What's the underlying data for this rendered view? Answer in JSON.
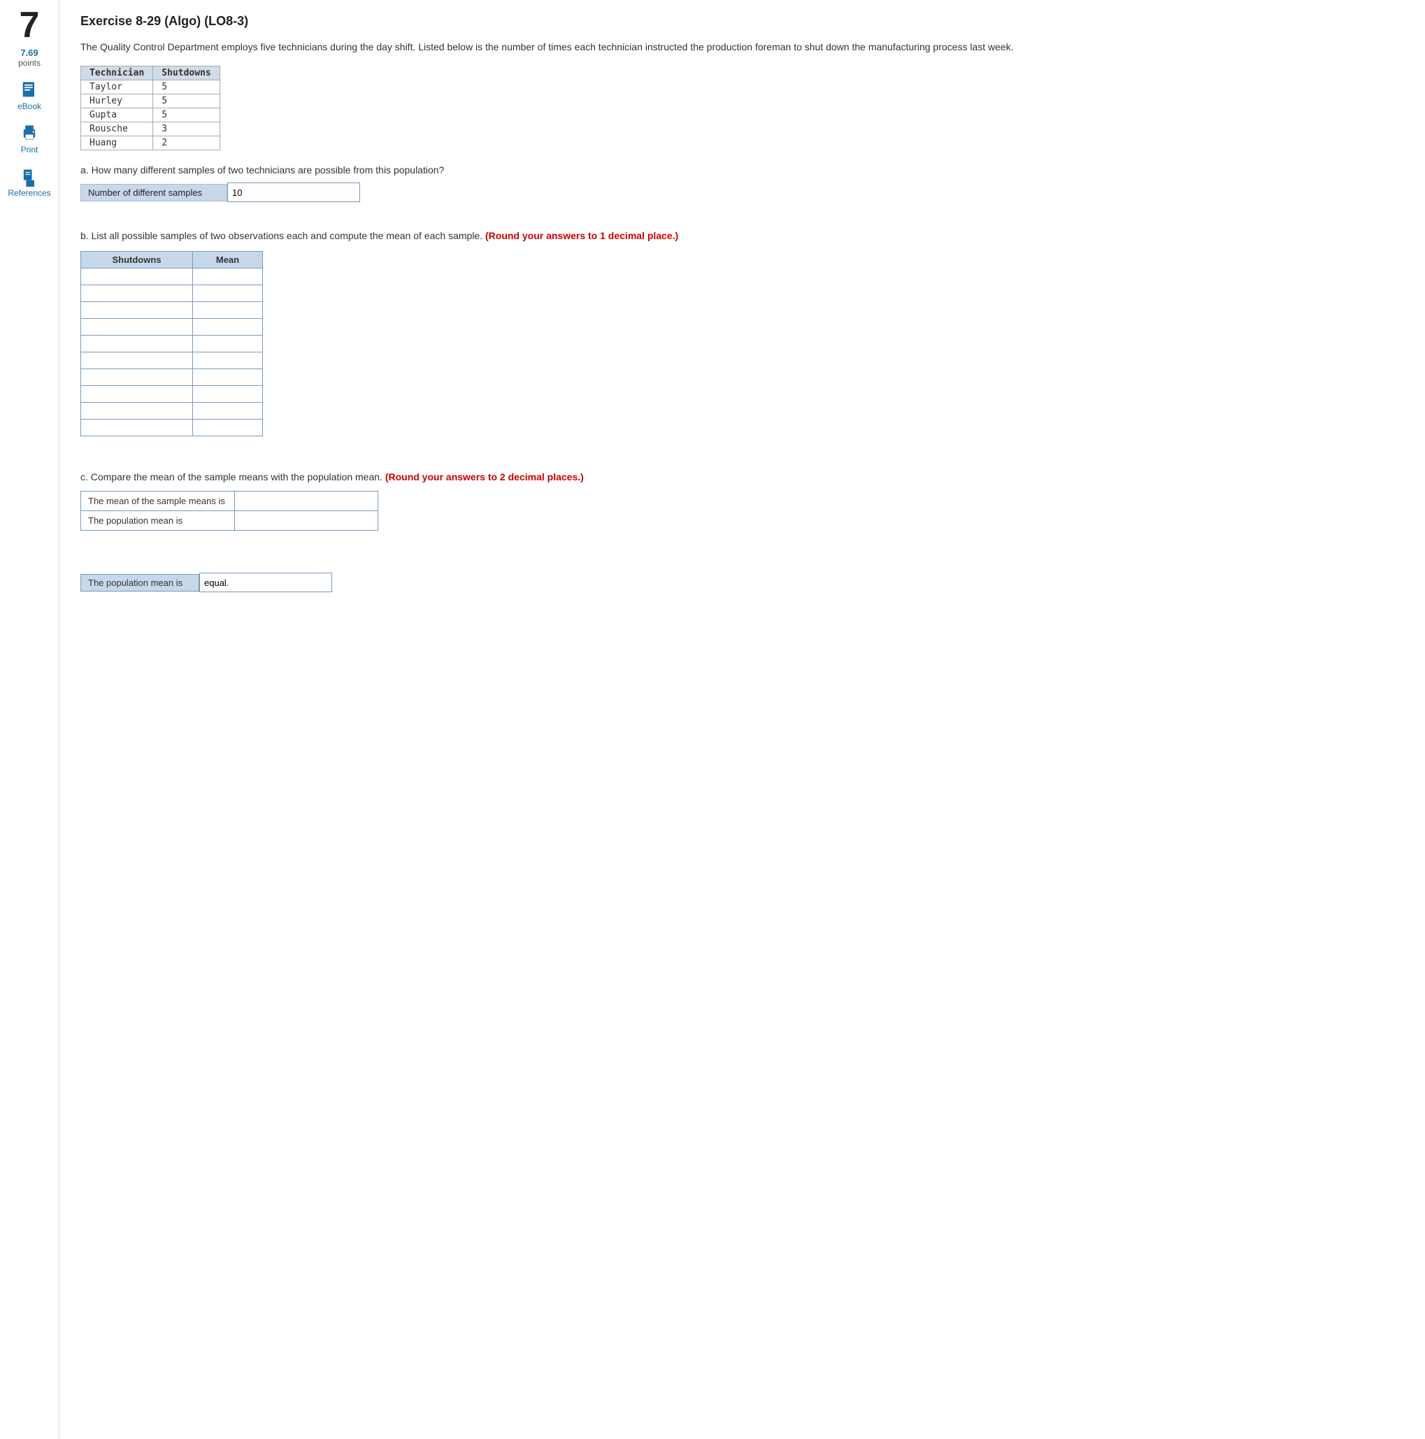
{
  "question_number": "7",
  "points": "7.69",
  "points_label": "points",
  "sidebar": {
    "ebook": "eBook",
    "print": "Print",
    "references": "References"
  },
  "exercise_title": "Exercise 8-29 (Algo) (LO8-3)",
  "intro_text": "The Quality Control Department employs five technicians during the day shift. Listed below is the number of times each technician instructed the production foreman to shut down the manufacturing process last week.",
  "data_table": {
    "headers": [
      "Technician",
      "Shutdowns"
    ],
    "rows": [
      [
        "Taylor",
        "5"
      ],
      [
        "Hurley",
        "5"
      ],
      [
        "Gupta",
        "5"
      ],
      [
        "Rousche",
        "3"
      ],
      [
        "Huang",
        "2"
      ]
    ]
  },
  "question_a": {
    "text": "a. How many different samples of two technicians are possible from this population?",
    "label": "Number of different samples",
    "value": "10"
  },
  "question_b": {
    "text": "b. List all possible samples of two observations each and compute the mean of each sample.",
    "round_note": "(Round your answers to 1 decimal place.)",
    "table_headers": [
      "Shutdowns",
      "Mean"
    ],
    "rows": 10
  },
  "question_c": {
    "text": "c. Compare the mean of the sample means with the population mean.",
    "round_note": "(Round your answers to 2 decimal places.)",
    "mean_label": "The mean of the sample means is",
    "mean_value": "",
    "pop_mean_label": "The population mean is",
    "pop_mean_value": ""
  },
  "question_d": {
    "pop_mean_label": "The population mean is",
    "pop_mean_value": "",
    "equal_text": "equal."
  }
}
